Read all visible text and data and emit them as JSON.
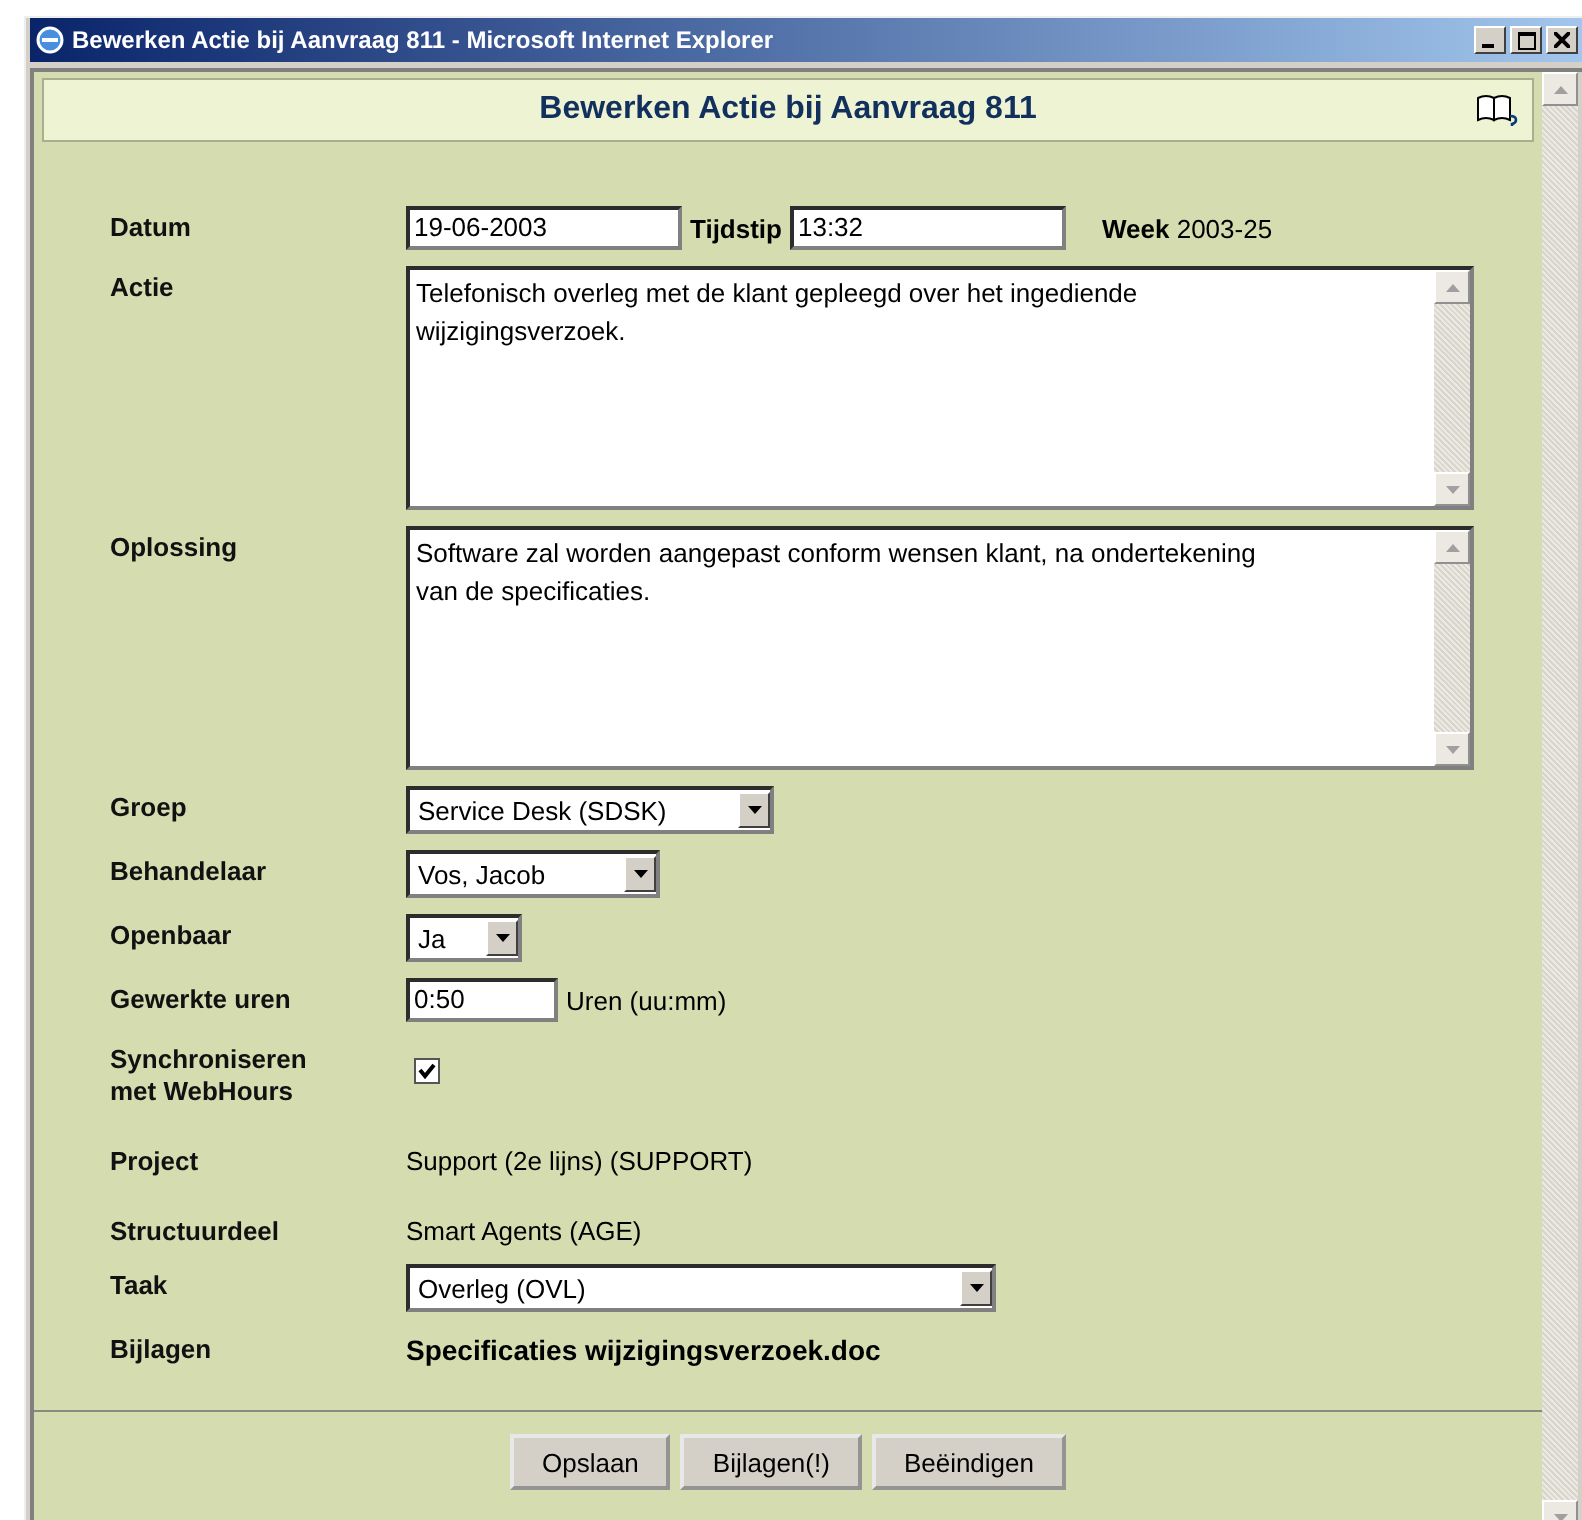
{
  "window": {
    "title": "Bewerken Actie bij Aanvraag 811 - Microsoft Internet Explorer"
  },
  "header": {
    "title": "Bewerken Actie bij Aanvraag 811"
  },
  "fields": [
    {
      "kind": "datetime",
      "label": "Datum",
      "date": "19-06-2003",
      "time_label": "Tijdstip",
      "time": "13:32",
      "week_label": "Week",
      "week": "2003-25"
    },
    {
      "kind": "textarea",
      "label": "Actie",
      "value": "Telefonisch overleg met de klant gepleegd over het ingediende wijzigingsverzoek."
    },
    {
      "kind": "textarea",
      "label": "Oplossing",
      "value": "Software zal worden aangepast conform wensen klant, na ondertekening van de specificaties."
    },
    {
      "kind": "select",
      "label": "Groep",
      "value": "Service Desk (SDSK)"
    },
    {
      "kind": "select",
      "label": "Behandelaar",
      "value": "Vos, Jacob"
    },
    {
      "kind": "select",
      "label": "Openbaar",
      "value": "Ja"
    },
    {
      "kind": "input",
      "label": "Gewerkte uren",
      "value": "0:50",
      "unit": "Uren (uu:mm)"
    },
    {
      "kind": "checkbox",
      "label": "Synchroniseren met WebHours",
      "checked": true
    },
    {
      "kind": "text",
      "label": "Project",
      "value": "Support (2e lijns) (SUPPORT)"
    },
    {
      "kind": "text",
      "label": "Structuurdeel",
      "value": "Smart Agents (AGE)"
    },
    {
      "kind": "select",
      "label": "Taak",
      "value": "Overleg (OVL)"
    },
    {
      "kind": "attachment",
      "label": "Bijlagen",
      "value": "Specificaties wijzigingsverzoek.doc"
    }
  ],
  "buttons": [
    "Opslaan",
    "Bijlagen(!)",
    "Beëindigen"
  ]
}
